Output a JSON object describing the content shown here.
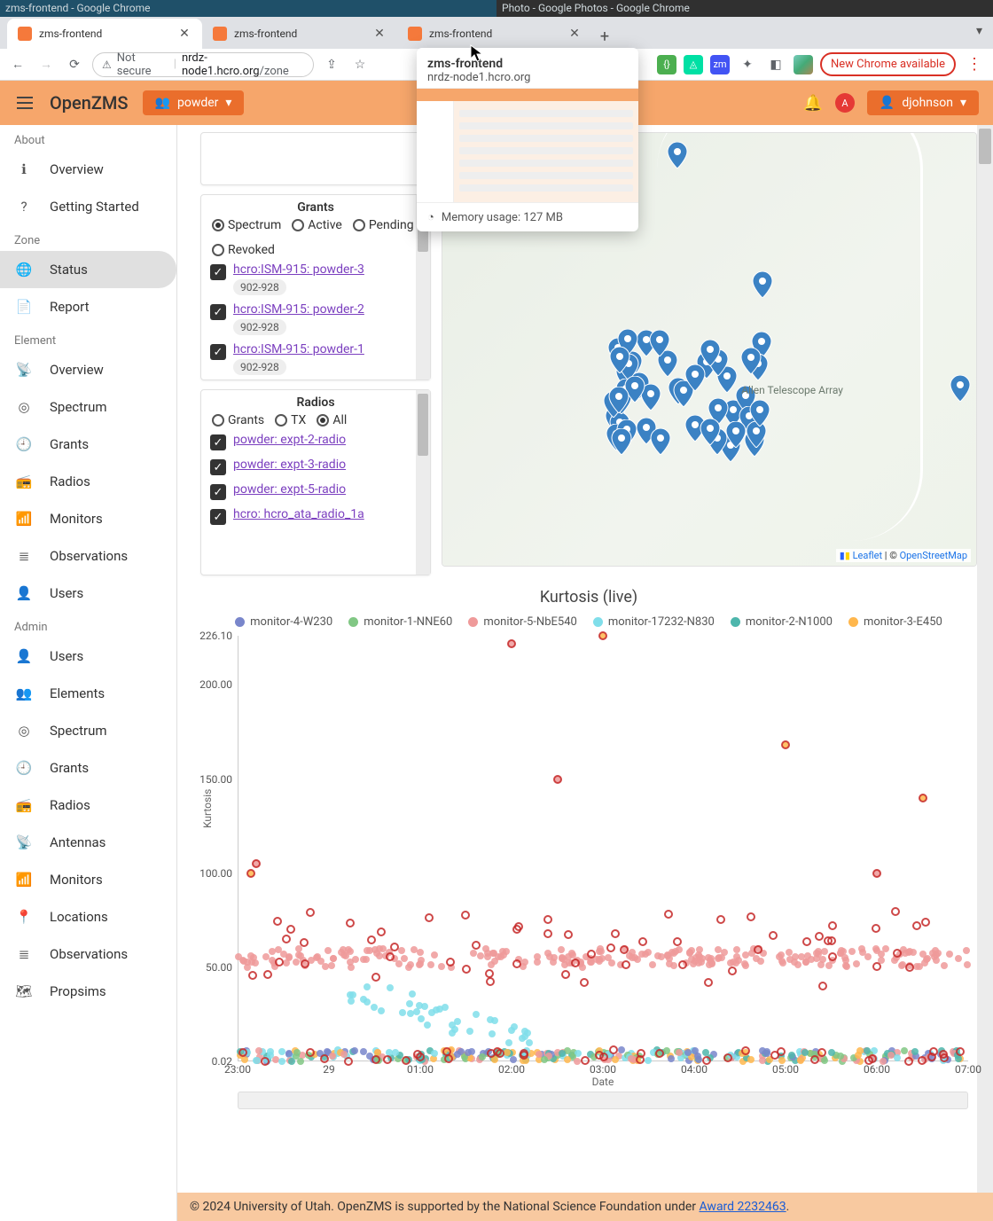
{
  "desktop": {
    "title1": "zms-frontend - Google Chrome",
    "title2": "Photo - Google Photos - Google Chrome"
  },
  "chrome": {
    "tabs": [
      {
        "title": "zms-frontend"
      },
      {
        "title": "zms-frontend"
      },
      {
        "title": "zms-frontend"
      }
    ],
    "omnibox": {
      "not_secure": "Not secure",
      "host": "nrdz-node1.hcro.org",
      "path": "/zone"
    },
    "new_chrome": "New Chrome available"
  },
  "tab_preview": {
    "title": "zms-frontend",
    "url": "nrdz-node1.hcro.org",
    "memory": "Memory usage: 127 MB"
  },
  "header": {
    "brand": "OpenZMS",
    "project": "powder",
    "user": "djohnson",
    "badge": "A"
  },
  "sidebar": {
    "about": "About",
    "zone": "Zone",
    "element": "Element",
    "admin": "Admin",
    "about_items": [
      "Overview",
      "Getting Started"
    ],
    "zone_items": [
      "Status",
      "Report"
    ],
    "element_items": [
      "Overview",
      "Spectrum",
      "Grants",
      "Radios",
      "Monitors",
      "Observations",
      "Users"
    ],
    "admin_items": [
      "Users",
      "Elements",
      "Spectrum",
      "Grants",
      "Radios",
      "Antennas",
      "Monitors",
      "Locations",
      "Observations",
      "Propsims"
    ]
  },
  "grants_panel": {
    "title": "Grants",
    "filters": [
      "Spectrum",
      "Active",
      "Pending",
      "Revoked"
    ],
    "selected_filter": "Spectrum",
    "items": [
      {
        "label": "hcro:ISM-915: powder-3",
        "chip": "902-928"
      },
      {
        "label": "hcro:ISM-915: powder-2",
        "chip": "902-928"
      },
      {
        "label": "hcro:ISM-915: powder-1",
        "chip": "902-928"
      }
    ]
  },
  "radios_panel": {
    "title": "Radios",
    "filters": [
      "Grants",
      "TX",
      "All"
    ],
    "selected_filter": "All",
    "items": [
      "powder: expt-2-radio",
      "powder: expt-3-radio",
      "powder: expt-5-radio",
      "hcro: hcro_ata_radio_1a"
    ]
  },
  "map": {
    "label": "Allen Telescope Array",
    "leaflet": "Leaflet",
    "osm": "OpenStreetMap",
    "sep": " | © "
  },
  "chart_data": {
    "type": "scatter",
    "title": "Kurtosis (live)",
    "ylabel": "Kurtosis",
    "xlabel": "Date",
    "ylim": [
      0.02,
      226.1
    ],
    "yticks": [
      0.02,
      50.0,
      100.0,
      150.0,
      200.0,
      226.1
    ],
    "x_categories": [
      "23:00",
      "29",
      "01:00",
      "02:00",
      "03:00",
      "04:00",
      "05:00",
      "06:00",
      "07:00"
    ],
    "series": [
      {
        "name": "monitor-4-W230",
        "color": "#7986cb"
      },
      {
        "name": "monitor-1-NNE60",
        "color": "#81c784"
      },
      {
        "name": "monitor-5-NbE540",
        "color": "#ef9a9a"
      },
      {
        "name": "monitor-17232-N830",
        "color": "#80deea"
      },
      {
        "name": "monitor-2-N1000",
        "color": "#4db6ac"
      },
      {
        "name": "monitor-3-E450",
        "color": "#ffb74d"
      }
    ],
    "bands": [
      {
        "series": "monitor-5-NbE540",
        "approx_y": 55,
        "note": "dense horizontal band across full x range"
      },
      {
        "series": "all",
        "approx_y": 1,
        "note": "dense baseline band near y≈0.02–5 across full x range"
      }
    ],
    "outliers": [
      {
        "series": "monitor-5-NbE540",
        "x": "02:00",
        "y": 222
      },
      {
        "series": "monitor-3-E450",
        "x": "03:00",
        "y": 226
      },
      {
        "series": "monitor-3-E450",
        "x": "05:00",
        "y": 168
      },
      {
        "series": "monitor-3-E450",
        "x": "06:30",
        "y": 140
      },
      {
        "series": "monitor-5-NbE540",
        "x": "02:30",
        "y": 150
      },
      {
        "series": "monitor-5-NbE540",
        "x": "06:00",
        "y": 100
      },
      {
        "series": "monitor-5-NbE540",
        "x": "23:20",
        "y": 105
      },
      {
        "series": "monitor-3-E450",
        "x": "23:15",
        "y": 100
      }
    ]
  },
  "footer": {
    "text_a": "© 2024 University of Utah. OpenZMS is supported by the National Science Foundation under ",
    "link": "Award 2232463",
    "text_b": "."
  }
}
